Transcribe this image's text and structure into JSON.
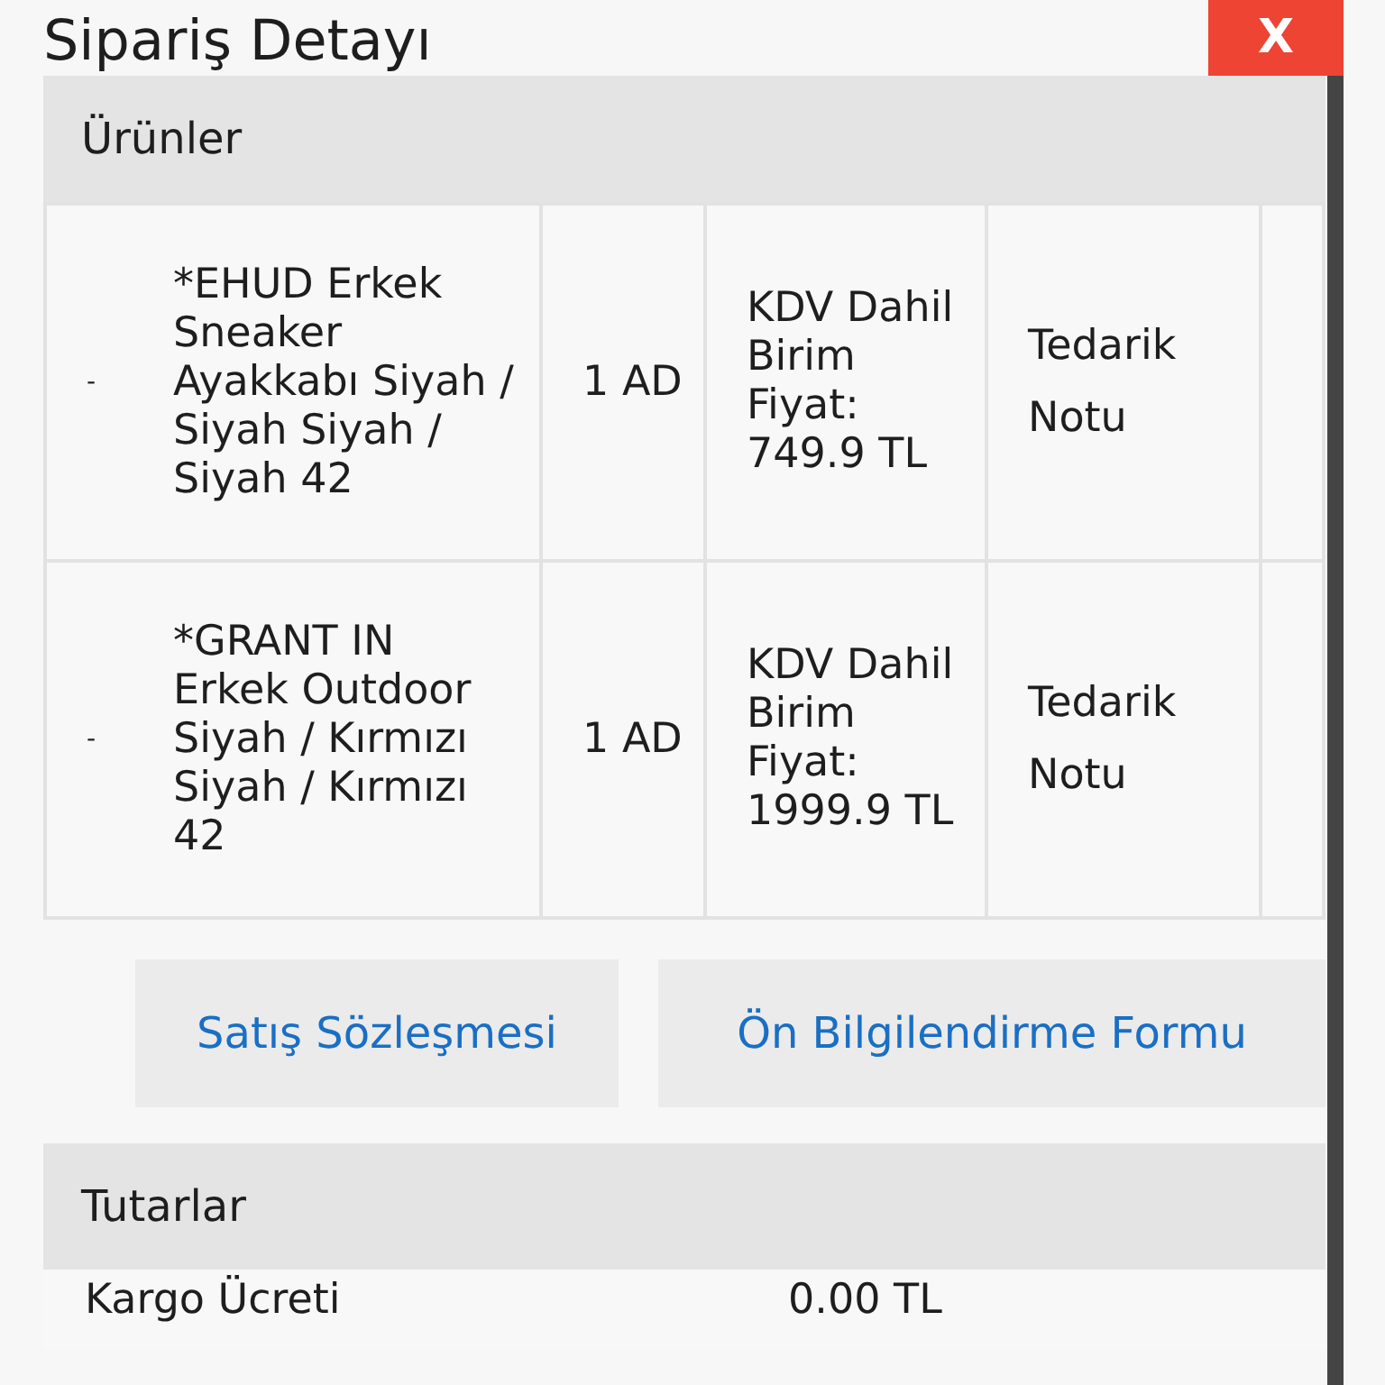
{
  "dialog": {
    "title": "Sipariş Detayı",
    "close": "X"
  },
  "products": {
    "heading": "Ürünler",
    "rows": [
      {
        "mark": "-",
        "name": "*EHUD Erkek Sneaker Ayakkabı Siyah / Siyah Siyah / Siyah 42",
        "quantity": "1 AD",
        "price": "KDV Dahil Birim Fiyat: 749.9 TL",
        "note": "Tedarik Notu"
      },
      {
        "mark": "-",
        "name": "*GRANT IN Erkek Outdoor Siyah / Kırmızı Siyah / Kırmızı 42",
        "quantity": "1 AD",
        "price": "KDV Dahil Birim Fiyat: 1999.9 TL",
        "note": "Tedarik Notu"
      }
    ]
  },
  "buttons": [
    "Satış Sözleşmesi",
    "Ön Bilgilendirme Formu"
  ],
  "totals": {
    "heading": "Tutarlar",
    "rows": [
      {
        "label": "Kargo Ücreti",
        "value": "0.00 TL"
      }
    ]
  }
}
